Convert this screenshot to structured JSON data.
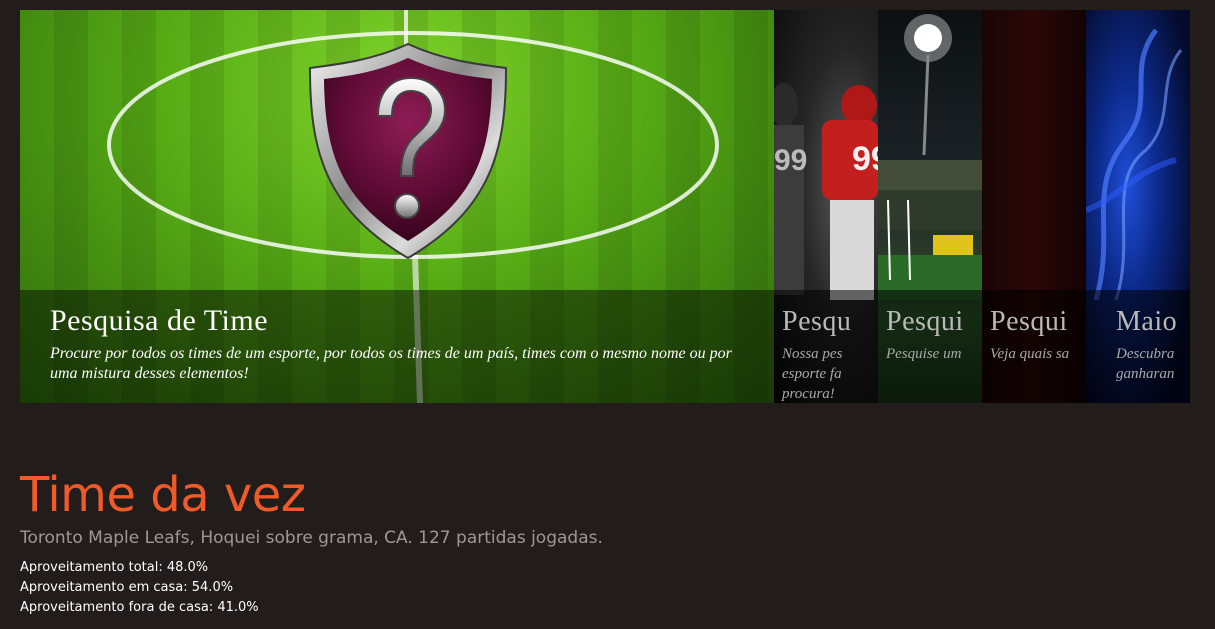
{
  "slider": {
    "slides": [
      {
        "title": "Pesquisa de Time",
        "text": "Procure por todos os times de um esporte, por todos os times de um país, times com o mesmo nome ou por uma mistura desses elementos!",
        "image": "shield-question-icon"
      },
      {
        "title": "Pesqu",
        "text": "Nossa pes esporte fa procura!",
        "image": "football-players"
      },
      {
        "title": "Pesqui",
        "text": "Pesquise um",
        "image": "stadium-lights"
      },
      {
        "title": "Pesqui",
        "text": "Veja quais sa",
        "image": "dark-red-curtain"
      },
      {
        "title": "Maio",
        "text": "Descubra ganharan",
        "image": "blue-smoke"
      }
    ]
  },
  "featured": {
    "heading": "Time da vez",
    "summary": "Toronto Maple Leafs, Hoquei sobre grama, CA. 127 partidas jogadas.",
    "stats": [
      {
        "label": "Aproveitamento total: 48.0%"
      },
      {
        "label": "Aproveitamento em casa: 54.0%"
      },
      {
        "label": "Aproveitamento fora de casa: 41.0%"
      }
    ]
  },
  "colors": {
    "page_background": "#221d1b",
    "heading_accent": "#f05a28",
    "summary_text": "#9d9895",
    "stat_text": "#ffffff"
  }
}
